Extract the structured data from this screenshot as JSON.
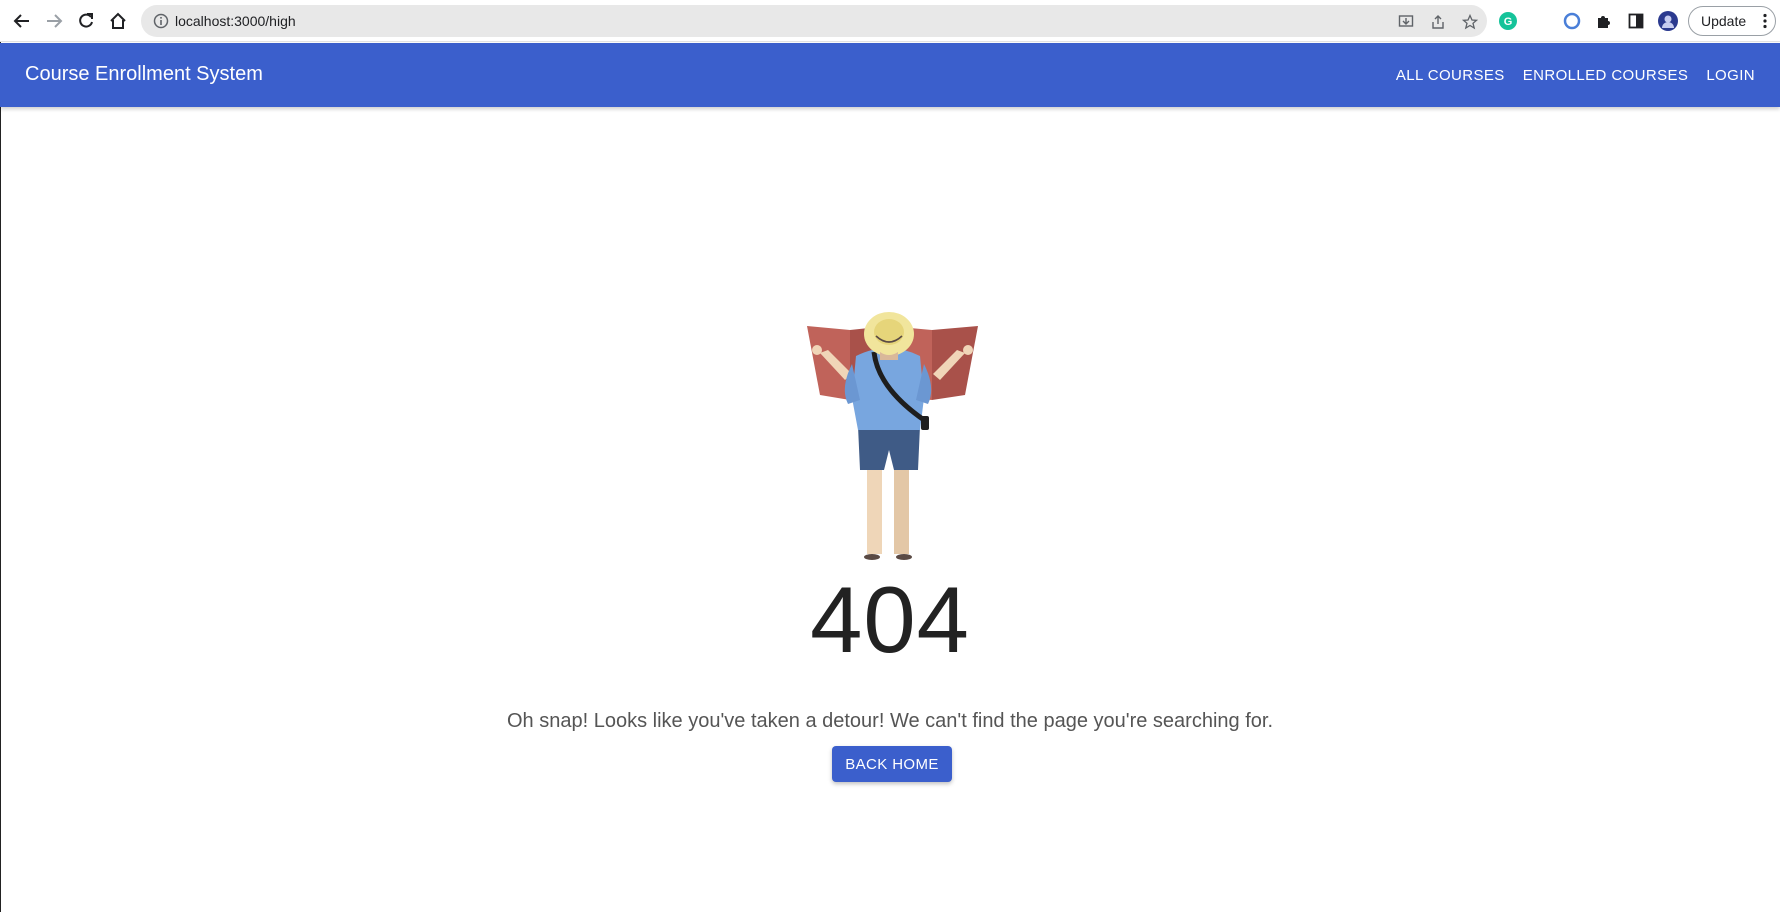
{
  "browser": {
    "url": "localhost:3000/high",
    "update_label": "Update",
    "icons": [
      "back-arrow-icon",
      "forward-arrow-icon",
      "reload-icon",
      "home-icon",
      "info-icon",
      "install-icon",
      "share-icon",
      "bookmark-star-icon",
      "grammarly-icon",
      "circle-extension-icon",
      "puzzle-extensions-icon",
      "side-panel-icon",
      "profile-avatar-icon",
      "more-vert-icon"
    ]
  },
  "appbar": {
    "title": "Course Enrollment System",
    "links": [
      {
        "label": "ALL COURSES"
      },
      {
        "label": "ENROLLED COURSES"
      },
      {
        "label": "LOGIN"
      }
    ]
  },
  "main": {
    "code": "404",
    "message": "Oh snap! Looks like you've taken a detour! We can't find the page you're searching for.",
    "button_label": "BACK HOME"
  },
  "colors": {
    "primary": "#3b5fcc",
    "text_dark": "#222222",
    "text_muted": "#555555"
  }
}
